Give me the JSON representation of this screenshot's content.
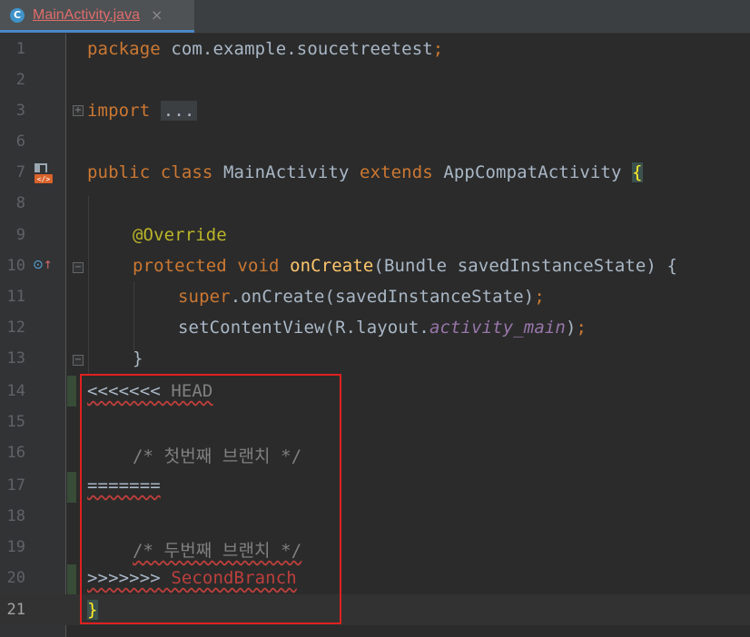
{
  "tab": {
    "file_name": "MainActivity.java",
    "icon_letter": "C",
    "close_glyph": "×"
  },
  "lines": {
    "n1": "1",
    "n2": "2",
    "n3": "3",
    "n4": "6",
    "n5": "7",
    "n6": "8",
    "n7": "9",
    "n8": "10",
    "n9": "11",
    "n10": "12",
    "n11": "13",
    "n12": "14",
    "n13": "15",
    "n14": "16",
    "n15": "17",
    "n16": "18",
    "n17": "19",
    "n18": "20",
    "n19": "21"
  },
  "code": {
    "l1_kw": "package",
    "l1_rest": " com.example.soucetreetest",
    "l1_semi": ";",
    "l3_kw": "import",
    "l3_fold": "...",
    "l7_kw1": "public",
    "l7_kw2": "class",
    "l7_name": " MainActivity ",
    "l7_kw3": "extends",
    "l7_parent": " AppCompatActivity ",
    "l7_brace": "{",
    "l9_ann": "@Override",
    "l10_kw1": "protected",
    "l10_kw2": "void",
    "l10_fn": "onCreate",
    "l10_rest": "(Bundle savedInstanceState) {",
    "l11_kw": "super",
    "l11_rest": ".onCreate(savedInstanceState)",
    "l11_semi": ";",
    "l12_a": "setContentView(R.layout.",
    "l12_fld": "activity_main",
    "l12_b": ")",
    "l12_semi": ";",
    "l13": "}",
    "l14_markers": "<<<<<<<",
    "l14_head": " HEAD",
    "l16": "/* 첫번째 브랜치 */",
    "l17": "=======",
    "l19": "/* 두번째 브랜치 */",
    "l20_markers": ">>>>>>>",
    "l20_branch": " SecondBranch",
    "l21": "}"
  },
  "colors": {
    "keyword": "#cc7832",
    "annotation": "#bbb529",
    "function": "#ffc66d",
    "field": "#9876aa",
    "comment": "#808080",
    "error": "#bc3f3c",
    "conflict_box": "#e02020"
  },
  "icons": {
    "run": "run-gutter-icon",
    "override": "override-method-icon"
  }
}
